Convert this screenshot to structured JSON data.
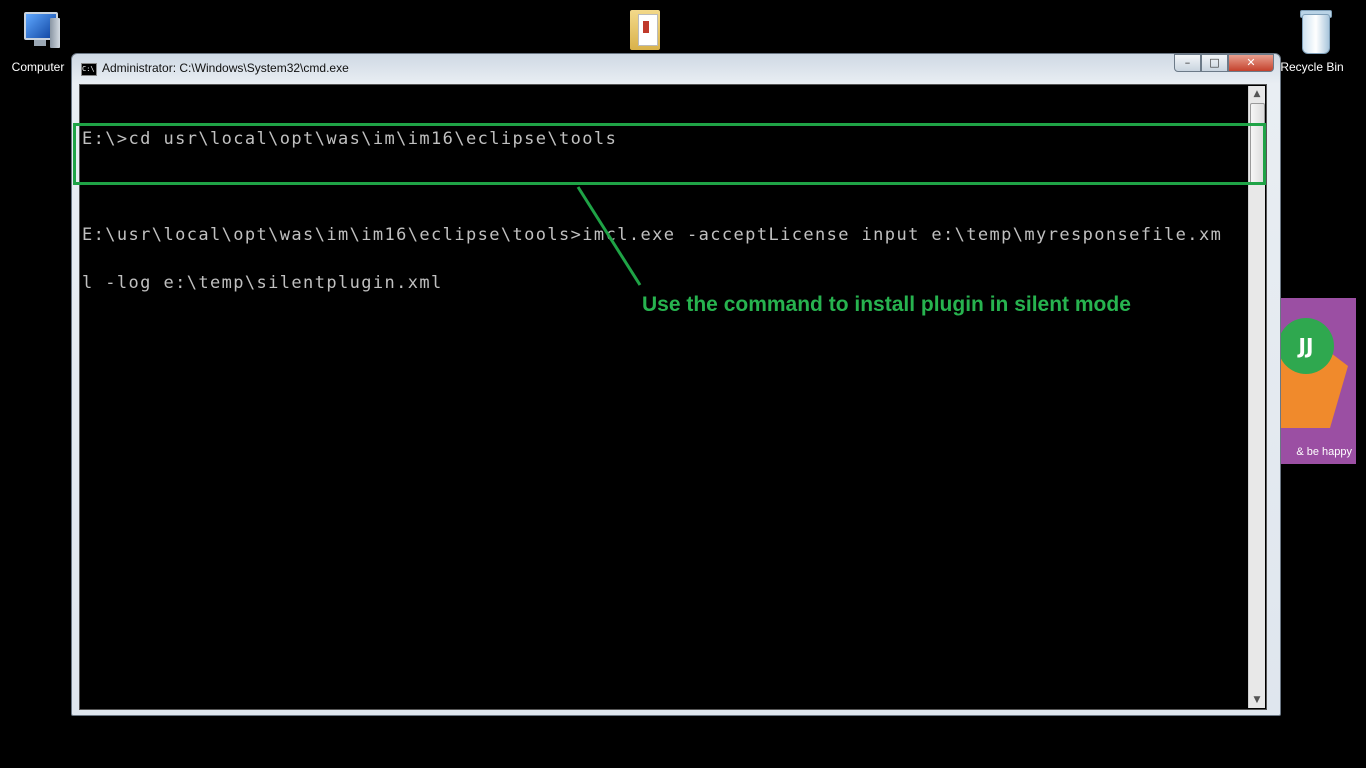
{
  "desktop": {
    "icons": [
      {
        "label": "Computer",
        "icon": "computer-icon"
      },
      {
        "label": "",
        "icon": "folder-icon"
      },
      {
        "label": "Recycle Bin",
        "icon": "recycle-bin-icon"
      }
    ],
    "gadget": {
      "badge_text": "ЈЈ",
      "caption": "& be happy"
    }
  },
  "window": {
    "title": "Administrator: C:\\Windows\\System32\\cmd.exe",
    "icon_text": "C:\\",
    "controls": {
      "minimize": "–",
      "maximize": "□",
      "close": "✕"
    }
  },
  "console": {
    "lines": [
      "E:\\>cd usr\\local\\opt\\was\\im\\im16\\eclipse\\tools",
      "",
      "E:\\usr\\local\\opt\\was\\im\\im16\\eclipse\\tools>imcl.exe -acceptLicense input e:\\temp\\myresponsefile.xm",
      "l -log e:\\temp\\silentplugin.xml"
    ]
  },
  "annotation": {
    "text": "Use the command to install plugin in silent mode",
    "color": "#27b34f"
  }
}
